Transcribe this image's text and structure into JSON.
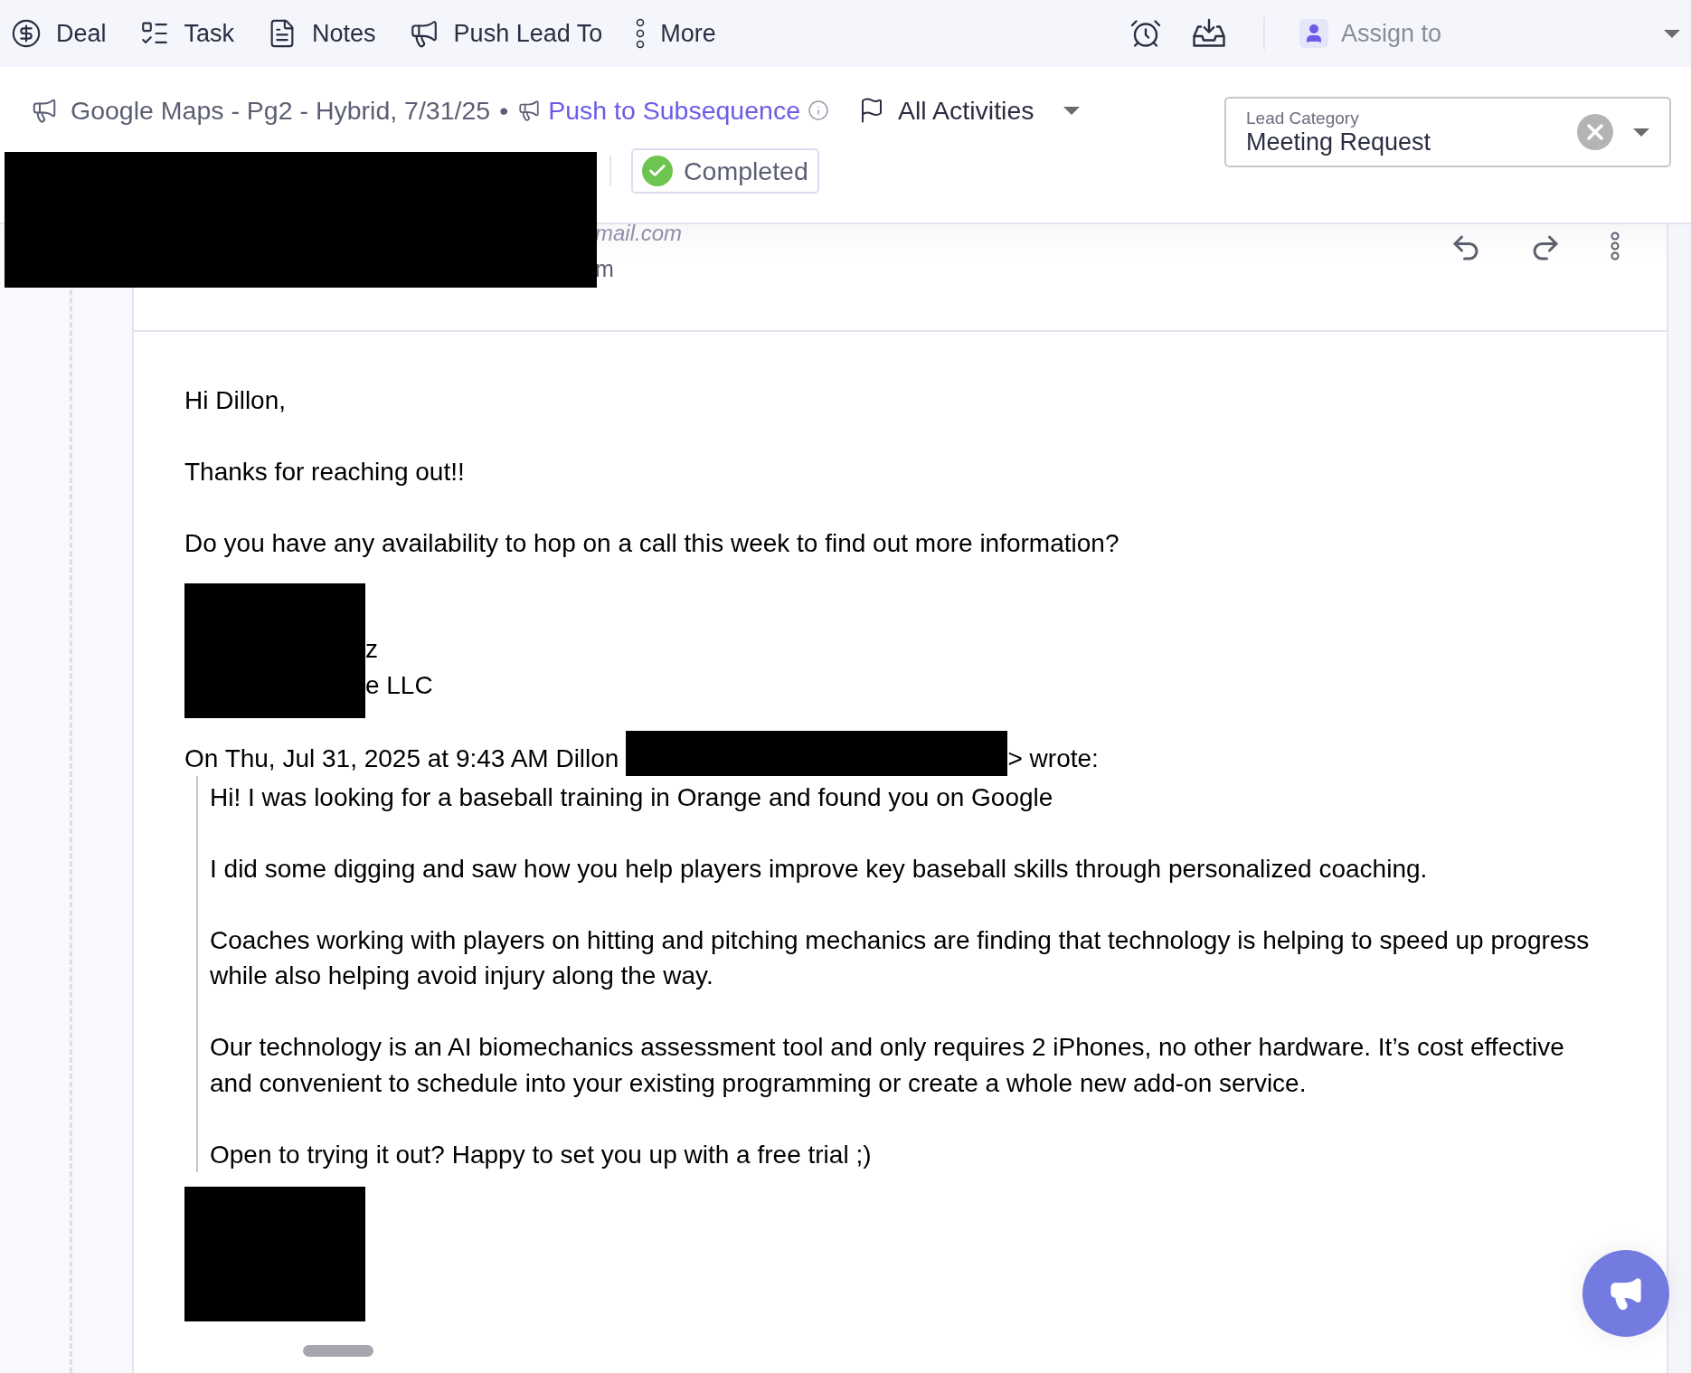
{
  "toolbar": {
    "actions": [
      {
        "label": "Deal"
      },
      {
        "label": "Task"
      },
      {
        "label": "Notes"
      },
      {
        "label": "Push Lead To"
      },
      {
        "label": "More"
      }
    ],
    "assign": {
      "label": "Assign to"
    }
  },
  "source": {
    "campaign": "Google Maps - Pg2 - Hybrid, 7/31/25",
    "separator": "•",
    "link": "Push to Subsequence"
  },
  "filter": {
    "label": "All Activities"
  },
  "lead_category": {
    "label": "Lead Category",
    "value": "Meeting Request"
  },
  "status": {
    "label": "Completed",
    "completed": true
  },
  "email": {
    "from_fragment": "mail.com",
    "to_fragment": "m",
    "paragraphs": [
      "Hi Dillon,",
      "Thanks for reaching out!!",
      "Do you have any availability to hop on a call this week to find out more information?"
    ],
    "signature": [
      "z",
      "e LLC"
    ],
    "quote": {
      "attribution": "On Thu, Jul 31, 2025 at 9:43 AM Dillon",
      "attribution_end": "> wrote:",
      "paragraphs": [
        "Hi! I was looking for a baseball training in Orange and found you on Google",
        "I did some digging and saw how you help players improve key baseball skills through personalized coaching.",
        "Coaches working with players on hitting and pitching mechanics are finding that technology is helping to speed up progress while also helping avoid injury along the way.",
        "Our technology is an AI biomechanics assessment tool and only requires 2 iPhones, no other hardware. It’s cost effective and convenient to schedule into your existing programming or create a whole new add-on service.",
        "Open to trying it out? Happy to set you up with a free trial ;)"
      ]
    }
  }
}
